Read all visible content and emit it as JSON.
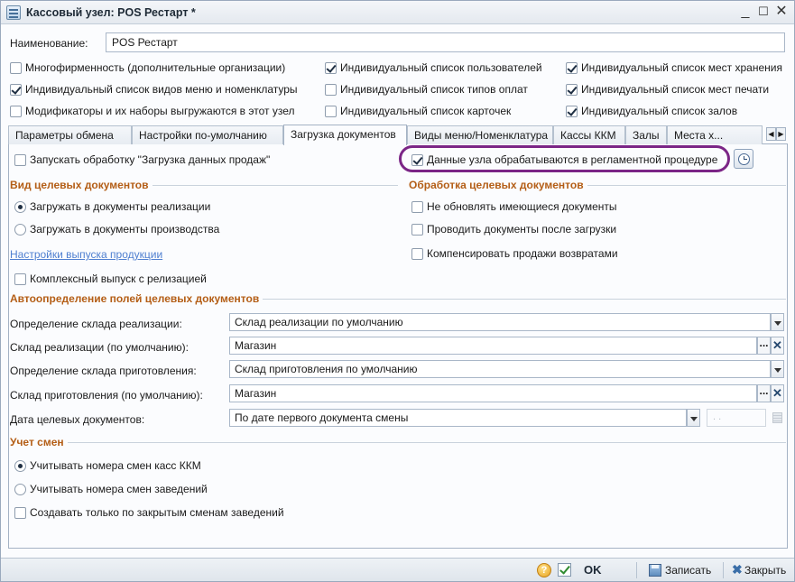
{
  "window": {
    "title": "Кассовый узел: POS Рестарт *",
    "minimize": "_",
    "maximize": "☐",
    "close": "✕"
  },
  "name_field": {
    "label": "Наименование:",
    "value": "POS Рестарт"
  },
  "options": [
    {
      "label": "Многофирменность  (дополнительные организации)",
      "checked": false
    },
    {
      "label": "Индивидуальный список пользователей",
      "checked": true
    },
    {
      "label": "Индивидуальный список мест хранения",
      "checked": true
    },
    {
      "label": "Индивидуальный список видов меню и номенклатуры",
      "checked": true
    },
    {
      "label": "Индивидуальный список типов оплат",
      "checked": false
    },
    {
      "label": "Индивидуальный список мест печати",
      "checked": true
    },
    {
      "label": "Модификаторы и их наборы выгружаются в этот узел",
      "checked": false
    },
    {
      "label": "Индивидуальный список карточек",
      "checked": false
    },
    {
      "label": "Индивидуальный список залов",
      "checked": true
    }
  ],
  "tabs": [
    {
      "label": "Параметры обмена",
      "active": false
    },
    {
      "label": "Настройки по-умолчанию",
      "active": false
    },
    {
      "label": "Загрузка документов",
      "active": true
    },
    {
      "label": "Виды меню/Номенклатура",
      "active": false
    },
    {
      "label": "Кассы ККМ",
      "active": false
    },
    {
      "label": "Залы",
      "active": false
    },
    {
      "label": "Места х...",
      "active": false
    }
  ],
  "tab_scroll": {
    "left": "◀",
    "right": "▶"
  },
  "panel": {
    "run_processing": {
      "label": "Запускать обработку \"Загрузка данных продаж\"",
      "checked": false
    },
    "node_data_processed": {
      "label": "Данные узла обрабатываются в регламентной процедуре",
      "checked": true
    },
    "target_docs_section": "Вид целевых документов",
    "processing_section": "Обработка целевых документов",
    "load_to_sales": {
      "label": "Загружать в документы реализации",
      "selected": true
    },
    "load_to_production": {
      "label": "Загружать в документы производства",
      "selected": false
    },
    "production_settings_link": "Настройки выпуска продукции",
    "complex_release": {
      "label": "Комплексный выпуск с релизацией",
      "checked": false
    },
    "no_update_docs": {
      "label": "Не обновлять имеющиеся документы",
      "checked": false
    },
    "post_after_load": {
      "label": "Проводить документы после загрузки",
      "checked": false
    },
    "compensate_returns": {
      "label": "Компенсировать продажи возвратами",
      "checked": false
    },
    "auto_fields_section": "Автоопределение полей целевых документов",
    "fields": {
      "sales_warehouse_def": {
        "label": "Определение склада реализации:",
        "value": "Склад реализации по умолчанию"
      },
      "sales_warehouse_default": {
        "label": "Склад реализации (по умолчанию):",
        "value": "Магазин"
      },
      "prep_warehouse_def": {
        "label": "Определение склада приготовления:",
        "value": "Склад приготовления по умолчанию"
      },
      "prep_warehouse_default": {
        "label": "Склад приготовления (по умолчанию):",
        "value": "Магазин"
      },
      "target_doc_date": {
        "label": "Дата целевых документов:",
        "value": "По дате первого документа смены",
        "date_placeholder": ". ."
      }
    },
    "select_button": "...",
    "clear_button": "✕",
    "shifts_section": "Учет смен",
    "use_kkm_shifts": {
      "label": "Учитывать номера смен касс ККМ",
      "selected": true
    },
    "use_venue_shifts": {
      "label": "Учитывать номера смен заведений",
      "selected": false
    },
    "only_closed_shifts": {
      "label": "Создавать только по закрытым сменам заведений",
      "checked": false
    }
  },
  "bottom_bar": {
    "help": "?",
    "ok": "OK",
    "save": "Записать",
    "close": "Закрыть",
    "close_glyph": "✖"
  },
  "colors": {
    "section_header": "#b45e16",
    "link": "#4f7fd0",
    "highlight": "#7b2586"
  }
}
